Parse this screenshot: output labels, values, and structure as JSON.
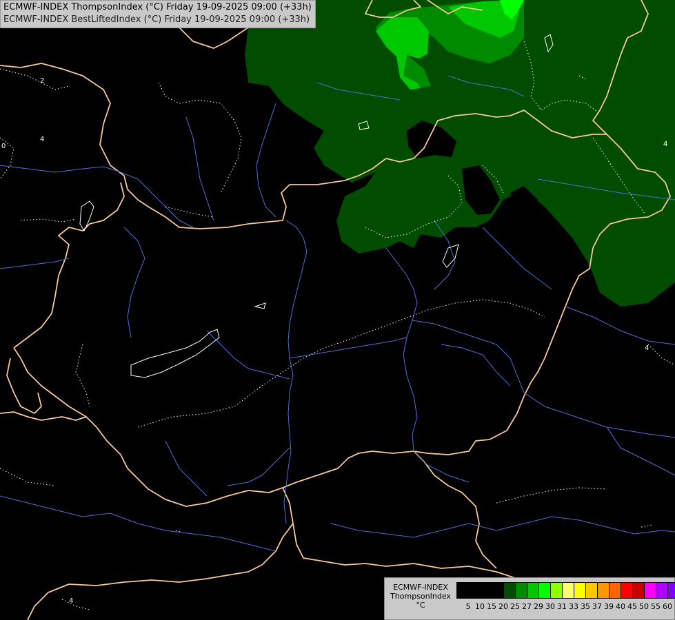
{
  "titles": {
    "line1": "ECMWF-INDEX ThompsonIndex (°C) Friday 19-09-2025 09:00 (+33h)",
    "line2": "ECMWF-INDEX BestLiftedIndex (°C) Friday 19-09-2025 09:00 (+33h)"
  },
  "legend": {
    "title_line1": "ECMWF-INDEX",
    "title_line2": "ThompsonIndex",
    "unit": "°C",
    "colors": [
      "#000000",
      "#000000",
      "#000000",
      "#000000",
      "#004d00",
      "#008a00",
      "#00c800",
      "#00ff00",
      "#90ff00",
      "#ffff70",
      "#ffff00",
      "#ffc800",
      "#ff9600",
      "#ff6400",
      "#ff0000",
      "#c80000",
      "#ff00ff",
      "#b400ff",
      "#8000ff",
      "#5000ff",
      "#0000ff"
    ],
    "ticks": [
      "5",
      "10",
      "15",
      "20",
      "25",
      "27",
      "29",
      "30",
      "31",
      "33",
      "35",
      "37",
      "39",
      "40",
      "45",
      "50",
      "55",
      "60"
    ]
  },
  "contour_labels": [
    "2",
    "4",
    "0",
    "4",
    "4",
    "4"
  ],
  "colors": {
    "background": "#000000",
    "green_dark": "#004d00",
    "green_mid": "#008a00",
    "green_light": "#00c800",
    "green_bright": "#00ff00",
    "border": "#f5c99a",
    "river": "#4f6fd6",
    "contour": "#ffffff"
  }
}
